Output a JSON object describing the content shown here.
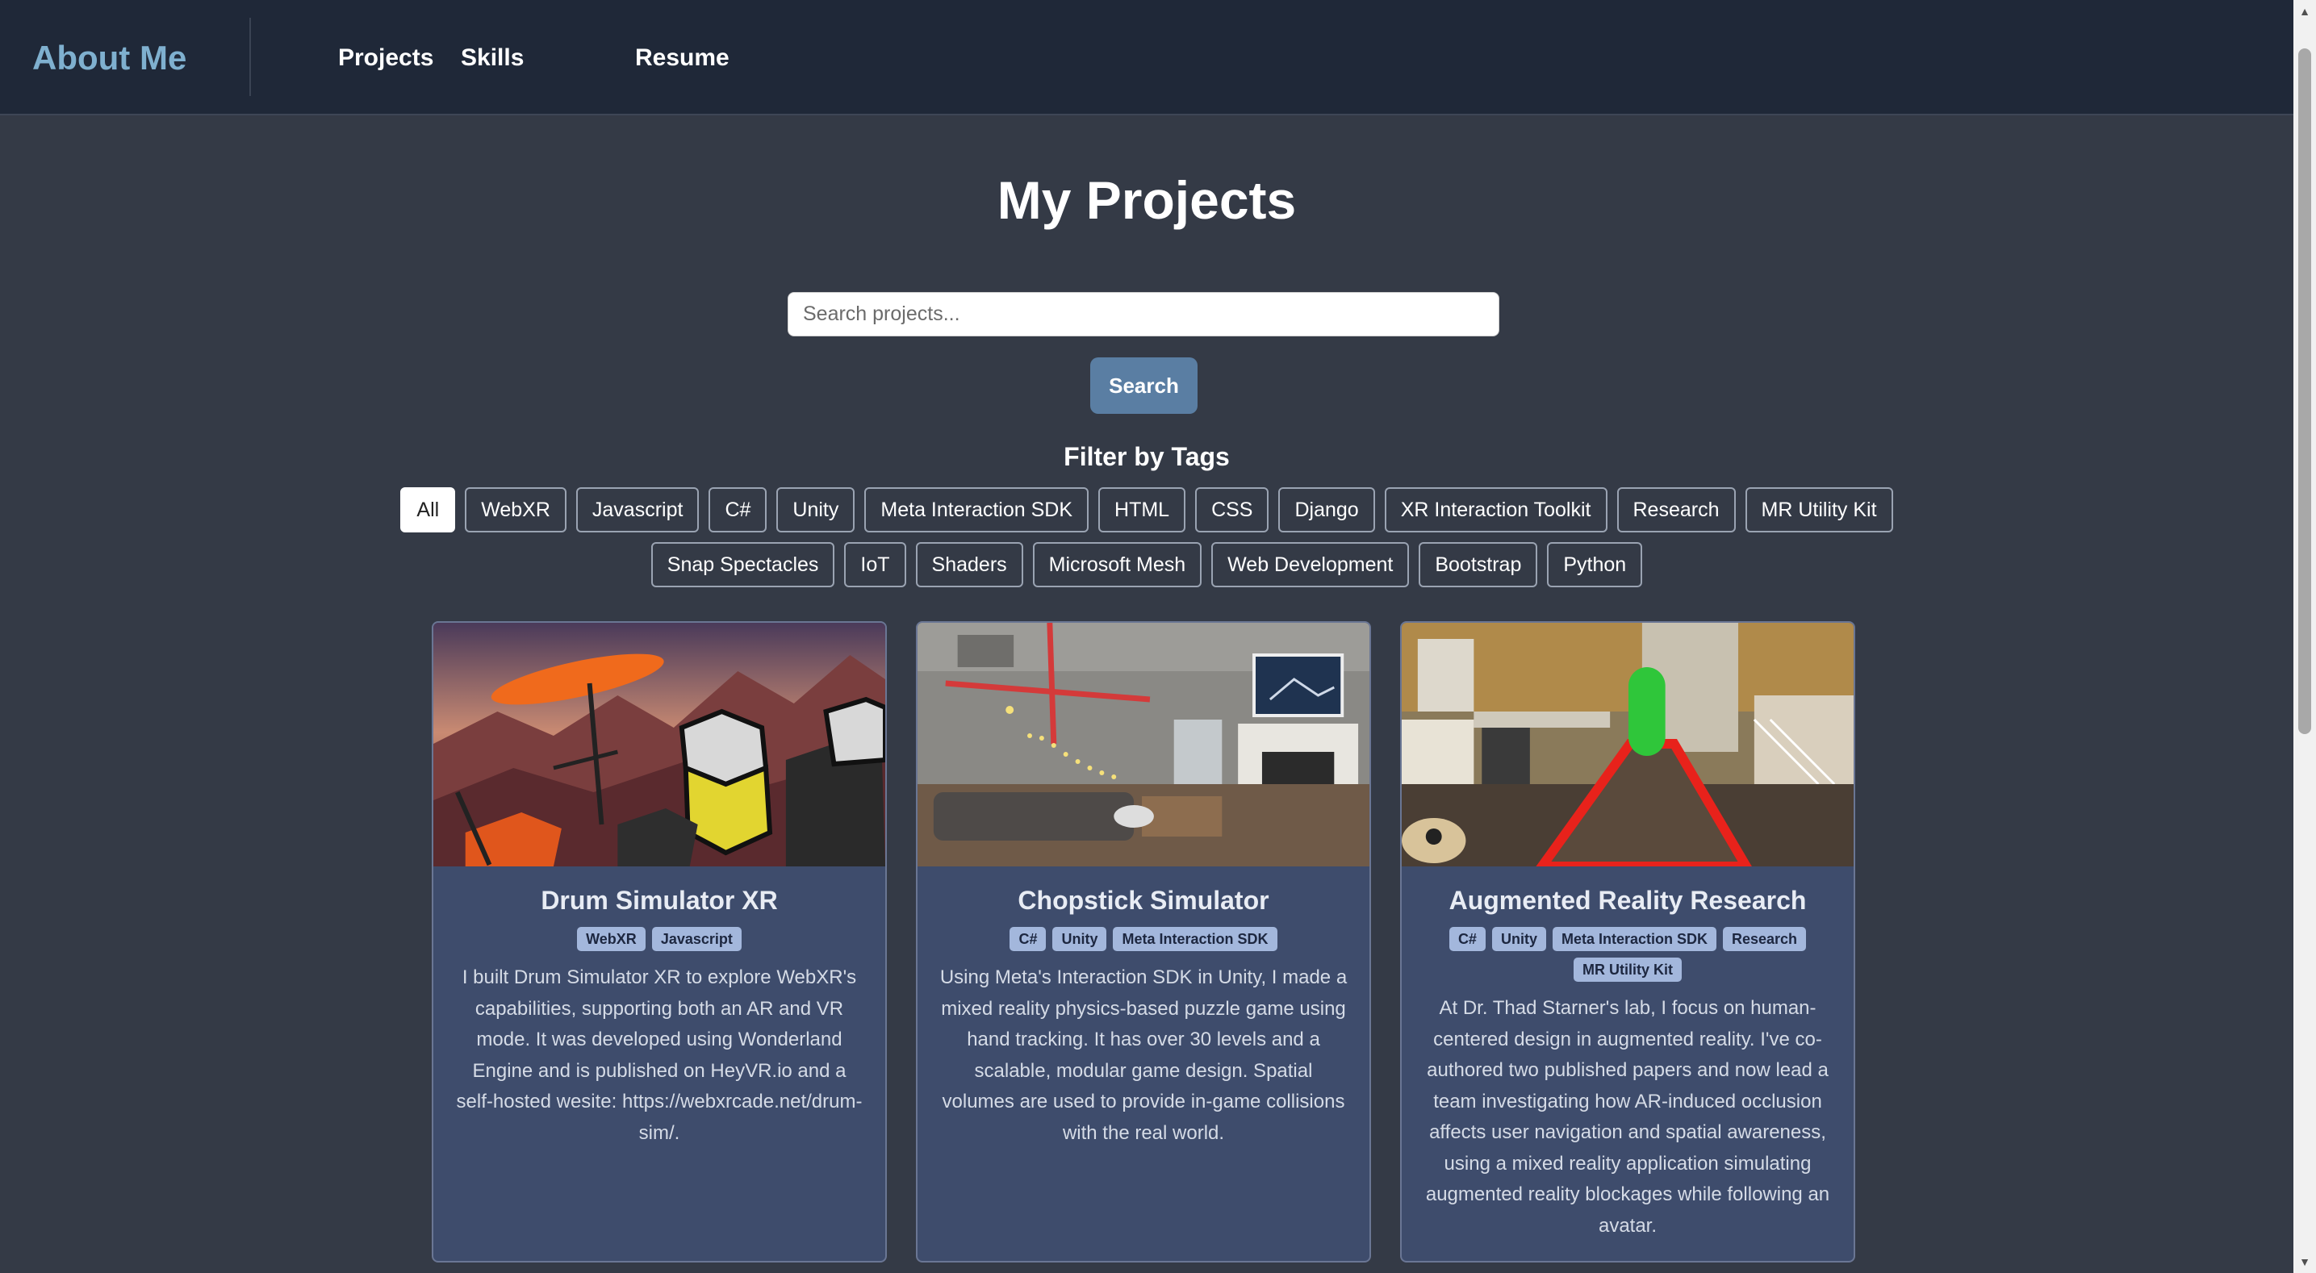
{
  "nav": {
    "brand": "About Me",
    "links": [
      "Projects",
      "Skills",
      "Resume"
    ]
  },
  "page": {
    "title": "My Projects",
    "search_placeholder": "Search projects...",
    "search_button": "Search",
    "filter_title": "Filter by Tags"
  },
  "filter_tags": {
    "row1": [
      "All",
      "WebXR",
      "Javascript",
      "C#",
      "Unity",
      "Meta Interaction SDK",
      "HTML",
      "CSS",
      "Django",
      "XR Interaction Toolkit",
      "Research",
      "MR Utility Kit"
    ],
    "row2": [
      "Snap Spectacles",
      "IoT",
      "Shaders",
      "Microsoft Mesh",
      "Web Development",
      "Bootstrap",
      "Python"
    ],
    "active": "All"
  },
  "projects": [
    {
      "title": "Drum Simulator XR",
      "tags": [
        "WebXR",
        "Javascript"
      ],
      "description": "I built Drum Simulator XR to explore WebXR's capabilities, supporting both an AR and VR mode. It was developed using Wonderland Engine and is published on HeyVR.io and a self-hosted wesite: https://webxrcade.net/drum-sim/."
    },
    {
      "title": "Chopstick Simulator",
      "tags": [
        "C#",
        "Unity",
        "Meta Interaction SDK"
      ],
      "description": "Using Meta's Interaction SDK in Unity, I made a mixed reality physics-based puzzle game using hand tracking. It has over 30 levels and a scalable, modular game design. Spatial volumes are used to provide in-game collisions with the real world."
    },
    {
      "title": "Augmented Reality Research",
      "tags": [
        "C#",
        "Unity",
        "Meta Interaction SDK",
        "Research",
        "MR Utility Kit"
      ],
      "description": "At Dr. Thad Starner's lab, I focus on human-centered design in augmented reality. I've co-authored two published papers and now lead a team investigating how AR-induced occlusion affects user navigation and spatial awareness, using a mixed reality application simulating augmented reality blockages while following an avatar."
    }
  ],
  "colors": {
    "background": "#343a46",
    "navbar": "#1f2838",
    "brand": "#7fb0cf",
    "card": "#3e4c6c",
    "chip": "#a3b7dc",
    "search_button": "#5a7ea3"
  }
}
